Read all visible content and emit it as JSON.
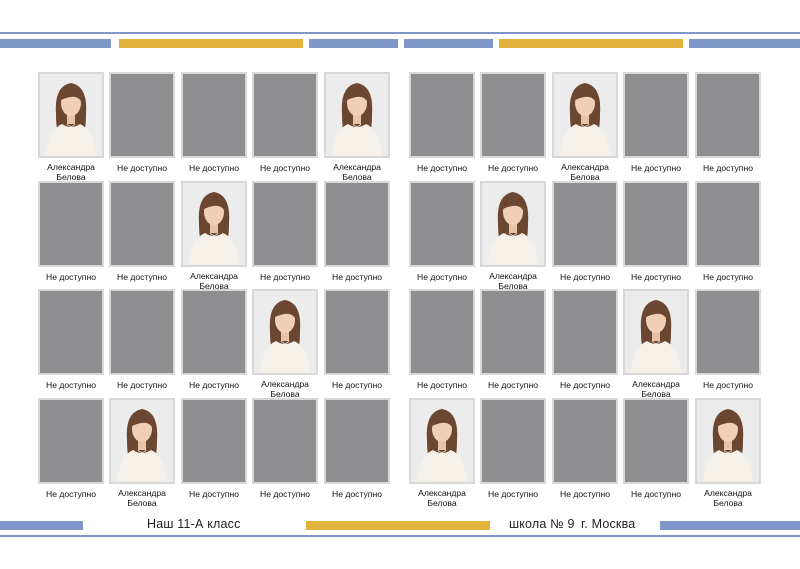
{
  "colors": {
    "blue": "#7e97c8",
    "gold": "#e2b33c",
    "placeholder": "#8e8d8f",
    "frame": "#d8d8d8"
  },
  "placeholder_label": "Не доступно",
  "student_name": "Александра\nБелова",
  "footer": {
    "class_title": "Наш 11-А класс",
    "school": "школа № 9",
    "city": "г. Москва"
  },
  "left_page": [
    [
      "photo",
      "empty",
      "empty",
      "empty",
      "photo"
    ],
    [
      "empty",
      "empty",
      "photo",
      "empty",
      "empty"
    ],
    [
      "empty",
      "empty",
      "empty",
      "photo",
      "empty"
    ],
    [
      "empty",
      "photo",
      "empty",
      "empty",
      "empty"
    ]
  ],
  "right_page": [
    [
      "empty",
      "empty",
      "photo",
      "empty",
      "empty"
    ],
    [
      "empty",
      "photo",
      "empty",
      "empty",
      "empty"
    ],
    [
      "empty",
      "empty",
      "empty",
      "photo",
      "empty"
    ],
    [
      "photo",
      "empty",
      "empty",
      "empty",
      "photo"
    ]
  ]
}
